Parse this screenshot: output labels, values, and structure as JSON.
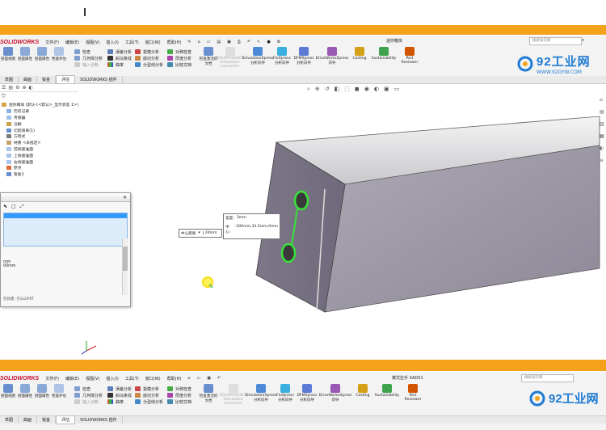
{
  "top_ribbon": {
    "logo": "SOLIDWORKS",
    "menu": [
      "文件(F)",
      "编辑(E)",
      "视图(V)",
      "插入(I)",
      "工具(T)",
      "窗口(W)",
      "帮助(H)"
    ],
    "doc_title": "迷你箱体",
    "search_placeholder": "搜索知识库",
    "tools_left": [
      {
        "label": "剖面视图",
        "icon": "section-view-icon"
      },
      {
        "label": "剖面属性",
        "icon": "section-props-icon"
      },
      {
        "label": "剖面属性",
        "icon": "section-props-icon"
      },
      {
        "label": "性能评估",
        "icon": "performance-icon"
      }
    ],
    "tools_col1": [
      "检查",
      "几何体分析",
      "输入诊断"
    ],
    "tools_col2": [
      "误差分析",
      "斜马条纹",
      "曲率"
    ],
    "tools_col3": [
      "拔模分析",
      "底切分析",
      "分型线分析"
    ],
    "tools_col4": [
      "对称检查",
      "厚度分析",
      "比较文档"
    ],
    "tools_special": "检查激活的文档",
    "tools_right": [
      {
        "label": "3DEXPERIENCE Simulation Connector",
        "icon": "3dx-icon"
      },
      {
        "label": "SimulationXpress 分析向导",
        "icon": "simxpress-icon"
      },
      {
        "label": "FloXpress 分析向导",
        "icon": "floxpress-icon"
      },
      {
        "label": "DFMXpress 分析向导",
        "icon": "dfmxpress-icon"
      },
      {
        "label": "DriveWorksXpress 向导",
        "icon": "driveworks-icon"
      },
      {
        "label": "Costing",
        "icon": "costing-icon"
      },
      {
        "label": "Sustainability",
        "icon": "sustainability-icon"
      },
      {
        "label": "Part Reviewer",
        "icon": "part-reviewer-icon"
      }
    ],
    "tabs": [
      "草图",
      "曲面",
      "钣金",
      "评估",
      "SOLIDWORKS 插件"
    ]
  },
  "watermark": {
    "brand": "92工业网",
    "url": "WWW.92GYW.COM"
  },
  "feature_tree": {
    "root": "迷你箱体 (默认<<默认>_显示状态 1>)",
    "items": [
      "历史记录",
      "传感器",
      "注解",
      "切割清单(1)",
      "方程式",
      "材质 <未指定>",
      "前视基准面",
      "上视基准面",
      "右视基准面",
      "原点",
      "钣金1"
    ]
  },
  "property_panel": {
    "value1": "mm",
    "value2": "00mm",
    "status": "在新建: 在SLDPRT"
  },
  "dims": {
    "label1": "宽度:",
    "value1": "3mm",
    "label2": "中心:",
    "value2": "-300mm,33.5mm,0mm",
    "ctx_label": "中心距离",
    "ctx_value": "20mm"
  },
  "bottom_ribbon": {
    "doc_title": "镂式拉手 XAD01"
  },
  "colors": {
    "orange": "#f5a21b",
    "viewport_bg": "#ffffff",
    "accent_green": "#39e23a"
  }
}
